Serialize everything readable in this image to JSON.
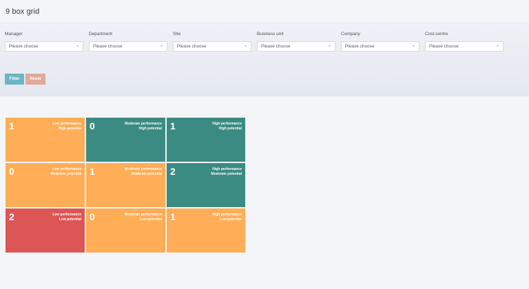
{
  "page": {
    "title": "9 box grid"
  },
  "filters": [
    {
      "label": "Manager",
      "value": "Please choose"
    },
    {
      "label": "Department",
      "value": "Please choose"
    },
    {
      "label": "Site",
      "value": "Please choose"
    },
    {
      "label": "Business unit",
      "value": "Please choose"
    },
    {
      "label": "Company",
      "value": "Please choose"
    },
    {
      "label": "Cost centre",
      "value": "Please choose"
    }
  ],
  "buttons": {
    "filter": "Filter",
    "reset": "Reset"
  },
  "colors": {
    "orange": "#ffad56",
    "teal": "#3b8b82",
    "red": "#dc5656",
    "filter_button": "#6cb6c4",
    "reset_button": "#e0a99a"
  },
  "grid": [
    {
      "count": "1",
      "performance": "Low performance",
      "potential": "High potential",
      "color": "orange"
    },
    {
      "count": "0",
      "performance": "Moderate performance",
      "potential": "High potential",
      "color": "teal"
    },
    {
      "count": "1",
      "performance": "High performance",
      "potential": "High potential",
      "color": "teal"
    },
    {
      "count": "0",
      "performance": "Low performance",
      "potential": "Moderate potential",
      "color": "orange"
    },
    {
      "count": "1",
      "performance": "Moderate performance",
      "potential": "Moderate potential",
      "color": "orange"
    },
    {
      "count": "2",
      "performance": "High performance",
      "potential": "Moderate potential",
      "color": "teal"
    },
    {
      "count": "2",
      "performance": "Low performance",
      "potential": "Low potential",
      "color": "red"
    },
    {
      "count": "0",
      "performance": "Moderate performance",
      "potential": "Low potential",
      "color": "orange"
    },
    {
      "count": "1",
      "performance": "High performance",
      "potential": "Low potential",
      "color": "orange"
    }
  ]
}
